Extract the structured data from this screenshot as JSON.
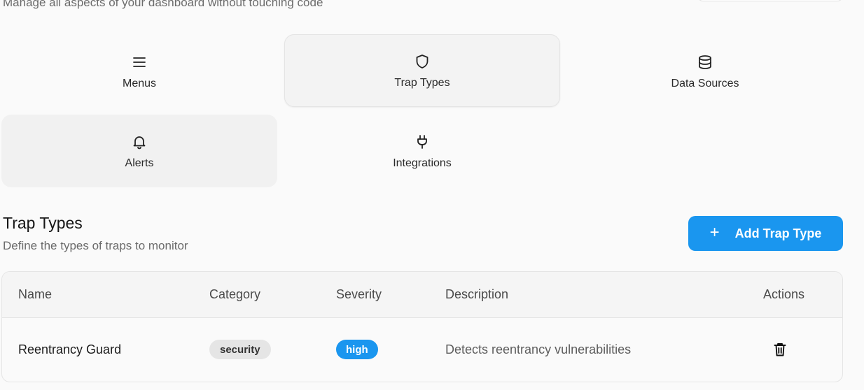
{
  "header": {
    "subtitle": "Manage all aspects of your dashboard without touching code"
  },
  "tiles": [
    {
      "label": "Menus",
      "icon": "menu-icon"
    },
    {
      "label": "Trap Types",
      "icon": "shield-icon",
      "active": true
    },
    {
      "label": "Data Sources",
      "icon": "database-icon"
    },
    {
      "label": "Alerts",
      "icon": "bell-icon"
    },
    {
      "label": "Integrations",
      "icon": "plug-icon"
    }
  ],
  "section": {
    "title": "Trap Types",
    "subtitle": "Define the types of traps to monitor",
    "add_button": "Add Trap Type",
    "add_icon": "plus-icon"
  },
  "table": {
    "columns": [
      "Name",
      "Category",
      "Severity",
      "Description",
      "Actions"
    ],
    "rows": [
      {
        "name": "Reentrancy Guard",
        "category": "security",
        "severity": "high",
        "description": "Detects reentrancy vulnerabilities",
        "action_icon": "trash-icon"
      }
    ]
  },
  "colors": {
    "accent": "#1a96ef",
    "background": "#fafafa",
    "muted_text": "#6b6b6b"
  }
}
